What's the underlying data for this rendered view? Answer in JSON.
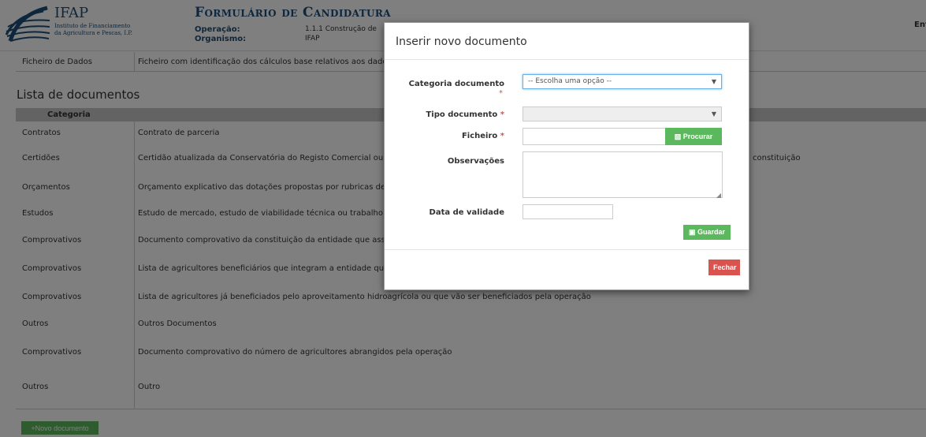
{
  "header": {
    "org_name": "IFAP",
    "org_sub_line1": "Instituto de Financiamento",
    "org_sub_line2": "da Agricultura e Pescas, I.P.",
    "form_title": "Formulário de Candidatura",
    "operacao_label": "Operação:",
    "operacao_value": "1.1.1 Construção de",
    "organismo_label": "Organismo:",
    "organismo_value": "IFAP",
    "right_text": "Ent"
  },
  "data_file_row": {
    "category": "Ficheiro de Dados",
    "description": "Ficheiro com identificação dos cálculos base relativos aos dados de"
  },
  "documents": {
    "title": "Lista de documentos",
    "column_category": "Categoria",
    "rows": [
      {
        "category": "Contratos",
        "description": "Contrato de parceria",
        "extra": ""
      },
      {
        "category": "Certidões",
        "description": "Certidão atualizada da Conservatória do Registo Comercial ou, no",
        "extra": "constituição"
      },
      {
        "category": "Orçamentos",
        "description": "Orçamento explicativo das dotações propostas por rubricas de inve",
        "extra": ""
      },
      {
        "category": "Estudos",
        "description": "Estudo de mercado, estudo de viabilidade técnica ou trabalho de le",
        "extra": ""
      },
      {
        "category": "Comprovativos",
        "description": "Documento comprovativo da constituição da entidade que assegur",
        "extra": ""
      },
      {
        "category": "Comprovativos",
        "description": "Lista de agricultores beneficiários que integram a entidade que ger",
        "extra": ""
      },
      {
        "category": "Comprovativos",
        "description": "Lista de agricultores já beneficiados pelo aproveitamento hidroagrícola ou que vão ser beneficiados pela operação",
        "extra": ""
      },
      {
        "category": "Outros",
        "description": "Outros Documentos",
        "extra": ""
      },
      {
        "category": "Comprovativos",
        "description": "Documento comprovativo do número de agricultores abrangidos pela operação",
        "extra": ""
      },
      {
        "category": "Outros",
        "description": "Outro",
        "extra": ""
      }
    ],
    "new_button": "+Novo documento"
  },
  "modal": {
    "title": "Inserir novo documento",
    "categoria_label": "Categoria documento",
    "categoria_value": "-- Escolha uma opção --",
    "tipo_label": "Tipo documento",
    "tipo_value": "",
    "ficheiro_label": "Ficheiro",
    "ficheiro_value": "",
    "procurar_button": "Procurar",
    "observacoes_label": "Observações",
    "observacoes_value": "",
    "validade_label": "Data de validade",
    "validade_value": "",
    "guardar_button": "Guardar",
    "fechar_button": "Fechar",
    "required_mark": "*"
  },
  "colors": {
    "brand": "#1e4e79",
    "success": "#5cb85c",
    "danger": "#d9534f"
  }
}
